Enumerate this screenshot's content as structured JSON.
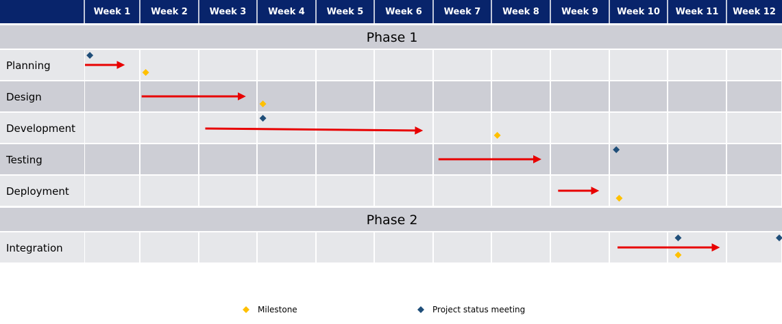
{
  "weeks": [
    "Week 1",
    "Week 2",
    "Week 3",
    "Week 4",
    "Week 5",
    "Week 6",
    "Week 7",
    "Week 8",
    "Week 9",
    "Week 10",
    "Week 11",
    "Week 12"
  ],
  "phases": [
    {
      "title": "Phase 1",
      "tasks": [
        {
          "name": "Planning",
          "start": 1.0,
          "end": 1.68
        },
        {
          "name": "Design",
          "start": 2.02,
          "end": 3.76
        },
        {
          "name": "Development",
          "start": 3.1,
          "end": 6.78
        },
        {
          "name": "Testing",
          "start": 7.08,
          "end": 8.8
        },
        {
          "name": "Deployment",
          "start": 9.12,
          "end": 9.78
        }
      ]
    },
    {
      "title": "Phase 2",
      "tasks": [
        {
          "name": "Integration",
          "start": 10.13,
          "end": 11.84
        }
      ]
    }
  ],
  "milestones": [
    {
      "task": "Planning",
      "week": 2.1
    },
    {
      "task": "Design",
      "week": 4.1
    },
    {
      "task": "Development",
      "week": 8.1
    },
    {
      "task": "Deployment",
      "week": 10.17
    },
    {
      "task": "Integration",
      "week": 11.18
    }
  ],
  "status_meetings": [
    {
      "task": "Planning",
      "week": 1.1
    },
    {
      "task": "Development",
      "week": 4.1
    },
    {
      "task": "Testing",
      "week": 10.12
    },
    {
      "task": "Integration",
      "week": 11.18
    },
    {
      "task": "Integration",
      "week": 13.0
    }
  ],
  "legend": {
    "milestone": "Milestone",
    "status_meeting": "Project status meeting"
  },
  "colors": {
    "header": "#08246b",
    "header_text": "#ffffff",
    "row_light": "#e6e7ea",
    "row_dark": "#cdced5",
    "arrow": "#e80000",
    "milestone": "#ffc000",
    "status_meeting": "#1f4e79"
  }
}
